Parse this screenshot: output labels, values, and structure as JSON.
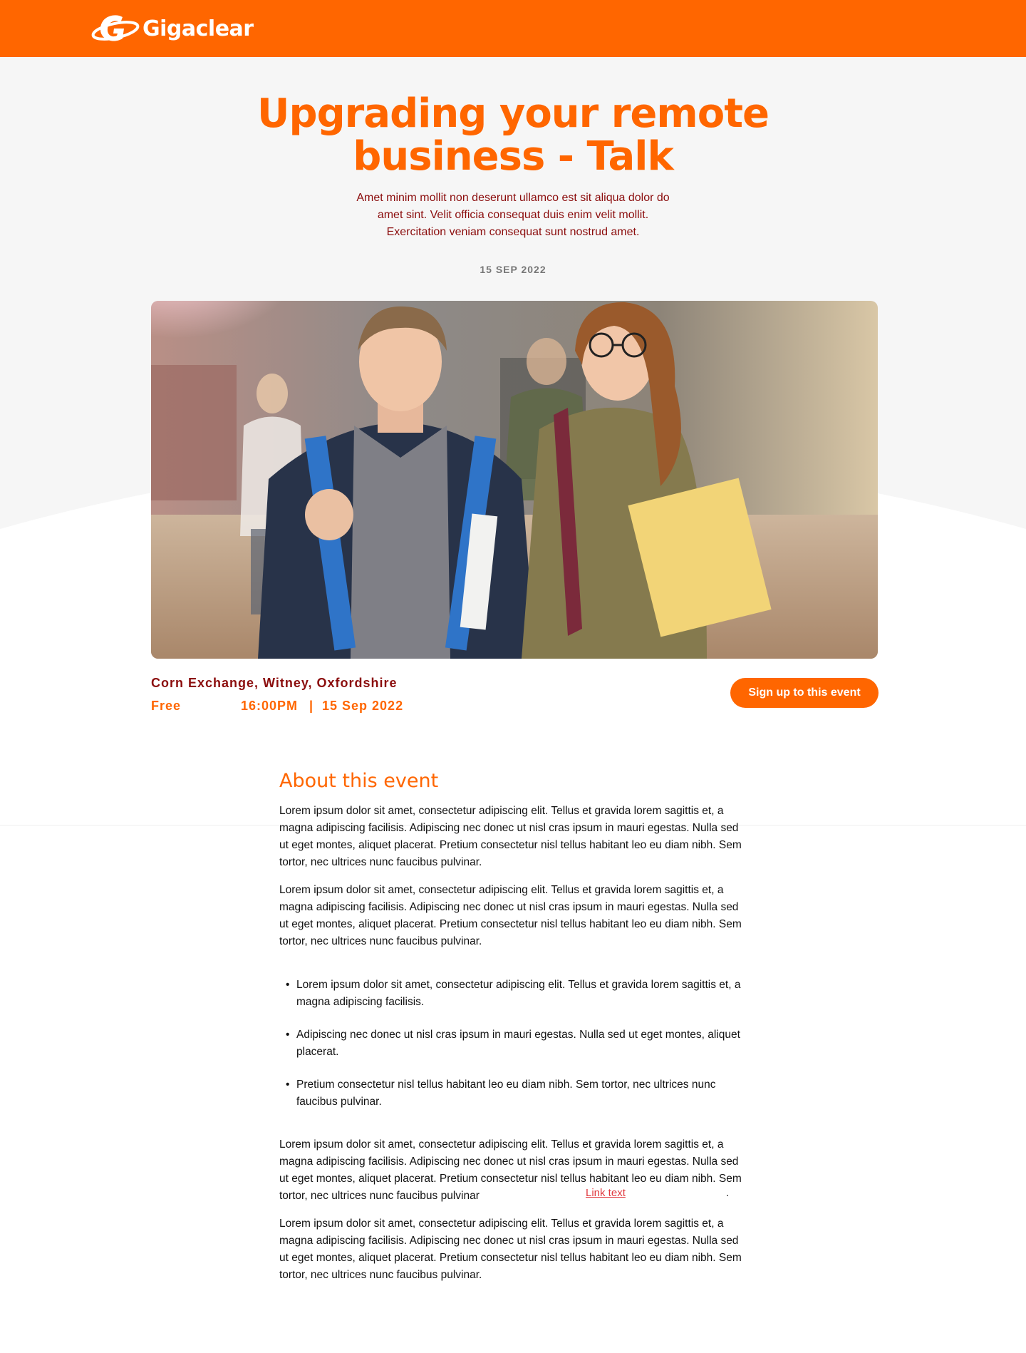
{
  "brand": {
    "name": "Gigaclear",
    "color": "#ff6600"
  },
  "event": {
    "title": "Upgrading your remote business - Talk",
    "intro": "Amet minim mollit non deserunt ullamco est sit aliqua dolor do amet sint. Velit officia consequat duis enim velit mollit. Exercitation veniam consequat sunt nostrud amet.",
    "date": "15 SEP 2022",
    "venue": "Corn Exchange, Witney, Oxfordshire",
    "price": "Free",
    "time": "16:00PM",
    "separator": "|",
    "event_date": "15 Sep 2022",
    "signup_label": "Sign up to this event"
  },
  "about": {
    "heading": "About this event",
    "paragraphs": [
      "Lorem ipsum dolor sit amet, consectetur adipiscing elit. Tellus et gravida lorem sagittis et, a magna adipiscing facilisis. Adipiscing nec donec ut nisl cras ipsum in mauri egestas. Nulla sed ut eget montes, aliquet placerat. Pretium consectetur nisl tellus habitant leo eu diam nibh. Sem tortor, nec ultrices nunc faucibus pulvinar.",
      "Lorem ipsum dolor sit amet, consectetur adipiscing elit. Tellus et gravida lorem sagittis et, a magna adipiscing facilisis. Adipiscing nec donec ut nisl cras ipsum in mauri egestas. Nulla sed ut eget montes, aliquet placerat. Pretium consectetur nisl tellus habitant leo eu diam nibh. Sem tortor, nec ultrices nunc faucibus pulvinar.",
      "Lorem ipsum dolor sit amet, consectetur adipiscing elit. Tellus et gravida lorem sagittis et, a magna adipiscing facilisis. Adipiscing nec donec ut nisl cras ipsum in mauri egestas. Nulla sed ut eget montes, aliquet placerat. Pretium consectetur nisl tellus habitant leo eu diam nibh. Sem tortor, nec ultrices nunc faucibus pulvinar",
      "Lorem ipsum dolor sit amet, consectetur adipiscing elit. Tellus et gravida lorem sagittis et, a magna adipiscing facilisis. Adipiscing nec donec ut nisl cras ipsum in mauri egestas. Nulla sed ut eget montes, aliquet placerat. Pretium consectetur nisl tellus habitant leo eu diam nibh. Sem tortor, nec ultrices nunc faucibus pulvinar."
    ],
    "bullets": [
      "Lorem ipsum dolor sit amet, consectetur adipiscing elit. Tellus et gravida lorem sagittis et, a magna adipiscing facilisis.",
      "Adipiscing nec donec ut nisl cras ipsum in mauri egestas. Nulla sed ut eget montes, aliquet placerat.",
      "Pretium consectetur nisl tellus habitant leo eu diam nibh. Sem tortor, nec ultrices nunc faucibus pulvinar."
    ],
    "link_text": "Link text",
    "trailing_period": "."
  }
}
